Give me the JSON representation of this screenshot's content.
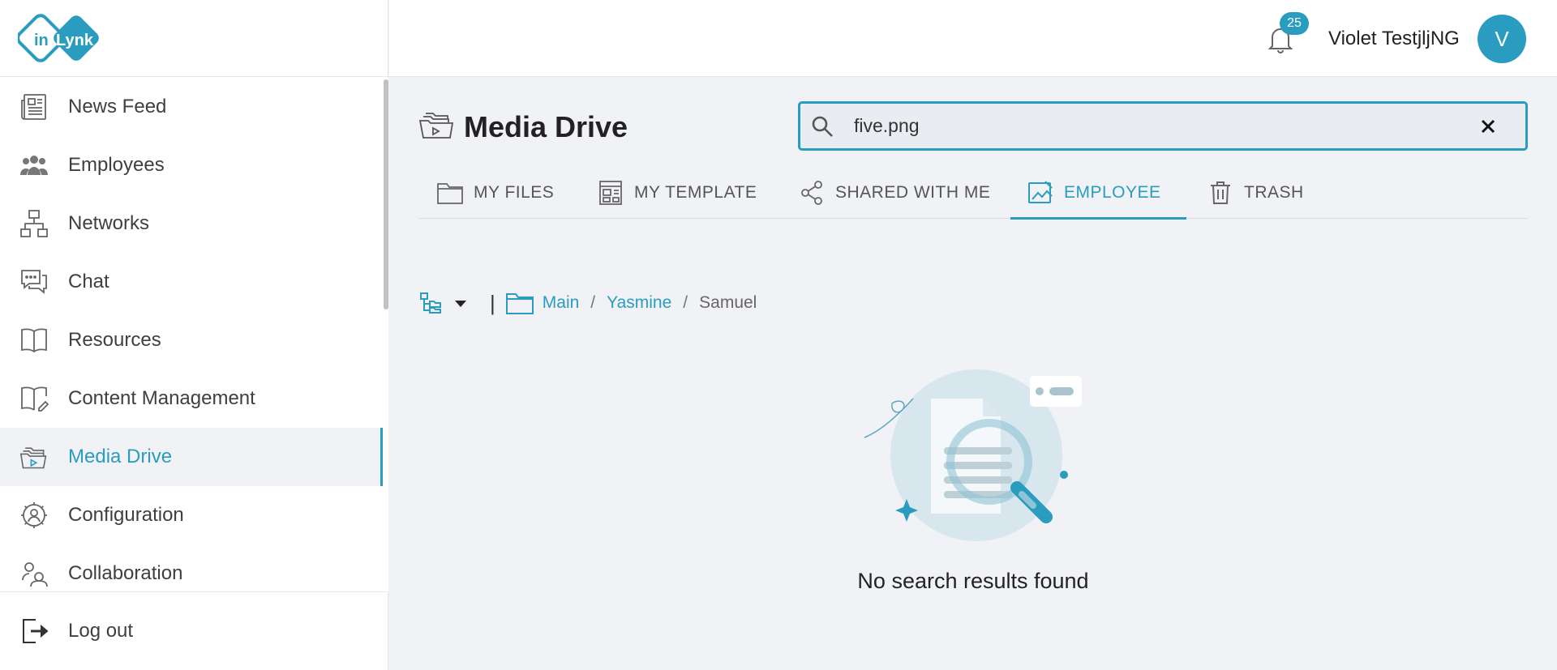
{
  "brand": {
    "logo_text_left": "in",
    "logo_text_right": "Lynk"
  },
  "sidebar": {
    "items": [
      {
        "label": "News Feed",
        "icon": "newspaper-icon"
      },
      {
        "label": "Employees",
        "icon": "people-group-icon"
      },
      {
        "label": "Networks",
        "icon": "network-icon"
      },
      {
        "label": "Chat",
        "icon": "chat-bubble-icon"
      },
      {
        "label": "Resources",
        "icon": "book-icon"
      },
      {
        "label": "Content Management",
        "icon": "book-edit-icon"
      },
      {
        "label": "Media Drive",
        "icon": "media-folder-icon",
        "active": true
      },
      {
        "label": "Configuration",
        "icon": "user-gear-icon"
      },
      {
        "label": "Collaboration",
        "icon": "collaboration-icon"
      }
    ],
    "logout": {
      "label": "Log out",
      "icon": "logout-icon"
    }
  },
  "header": {
    "notifications_count": "25",
    "user_name": "Violet TestjljNG",
    "avatar_initial": "V"
  },
  "main": {
    "title": "Media Drive",
    "search": {
      "value": "five.png"
    },
    "tabs": [
      {
        "label": "MY FILES",
        "icon": "folder-icon"
      },
      {
        "label": "MY TEMPLATE",
        "icon": "template-icon"
      },
      {
        "label": "SHARED WITH ME",
        "icon": "share-icon"
      },
      {
        "label": "EMPLOYEE",
        "icon": "image-chart-icon",
        "active": true
      },
      {
        "label": "TRASH",
        "icon": "trash-icon"
      }
    ],
    "breadcrumb": {
      "separator": "|",
      "path": [
        "Main",
        "Yasmine"
      ],
      "slash": "/",
      "current": "Samuel"
    },
    "empty_state": {
      "message": "No search results found"
    }
  },
  "colors": {
    "accent": "#2a9cbf",
    "background": "#f0f2f6"
  }
}
